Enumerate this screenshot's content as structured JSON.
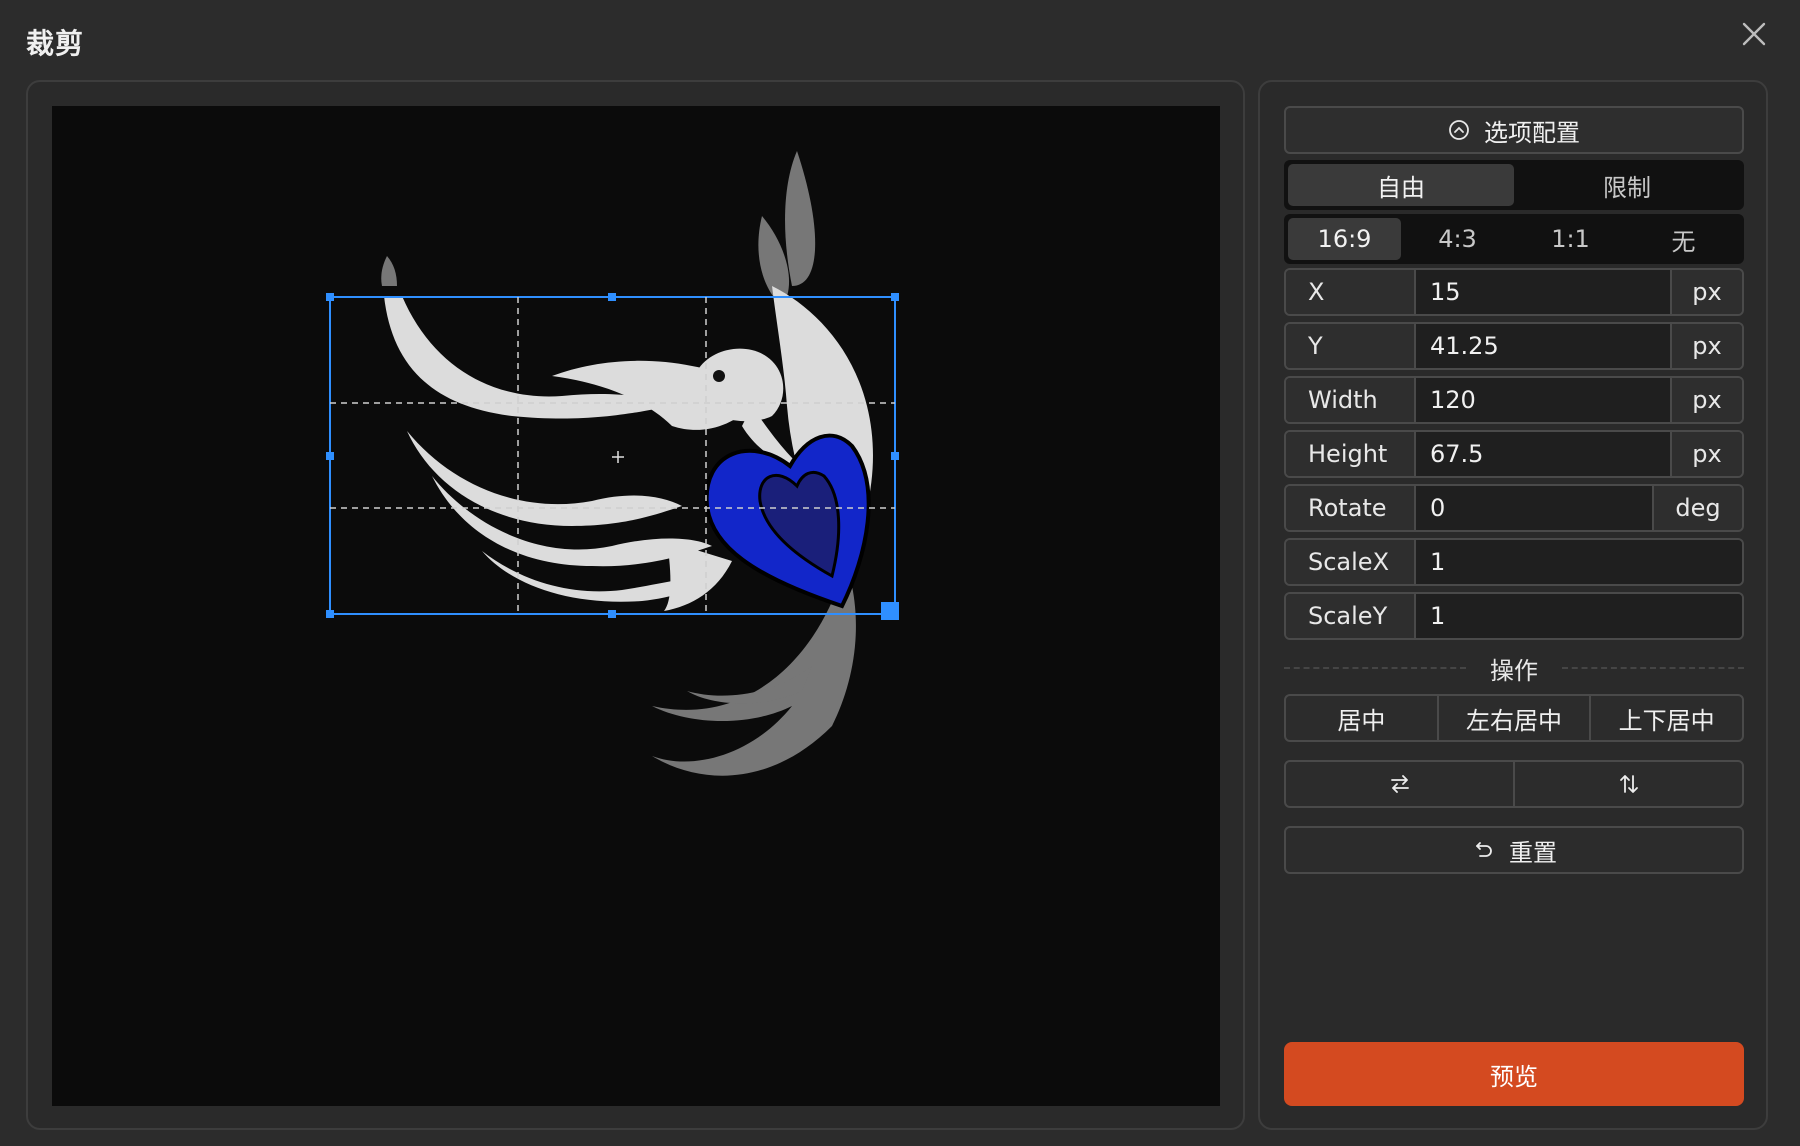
{
  "dialog": {
    "title": "裁剪"
  },
  "panel": {
    "options_toggle": "选项配置",
    "mode_tabs": [
      {
        "label": "自由",
        "active": true
      },
      {
        "label": "限制",
        "active": false
      }
    ],
    "ratio_tabs": [
      {
        "label": "16:9",
        "active": true
      },
      {
        "label": "4:3",
        "active": false
      },
      {
        "label": "1:1",
        "active": false
      },
      {
        "label": "无",
        "active": false
      }
    ],
    "fields": {
      "x": {
        "label": "X",
        "value": "15",
        "unit": "px"
      },
      "y": {
        "label": "Y",
        "value": "41.25",
        "unit": "px"
      },
      "width": {
        "label": "Width",
        "value": "120",
        "unit": "px"
      },
      "height": {
        "label": "Height",
        "value": "67.5",
        "unit": "px"
      },
      "rotate": {
        "label": "Rotate",
        "value": "0",
        "unit": "deg"
      },
      "scale_x": {
        "label": "ScaleX",
        "value": "1"
      },
      "scale_y": {
        "label": "ScaleY",
        "value": "1"
      }
    },
    "operations_heading": "操作",
    "align_buttons": [
      "居中",
      "左右居中",
      "上下居中"
    ],
    "flip_buttons": {
      "horizontal_icon": "swap-horizontal-icon",
      "vertical_icon": "swap-vertical-icon"
    },
    "reset_label": "重置",
    "preview_label": "预览"
  },
  "colors": {
    "accent": "#d44a20",
    "selection": "#2f8fff",
    "heart": "#1226c9"
  }
}
